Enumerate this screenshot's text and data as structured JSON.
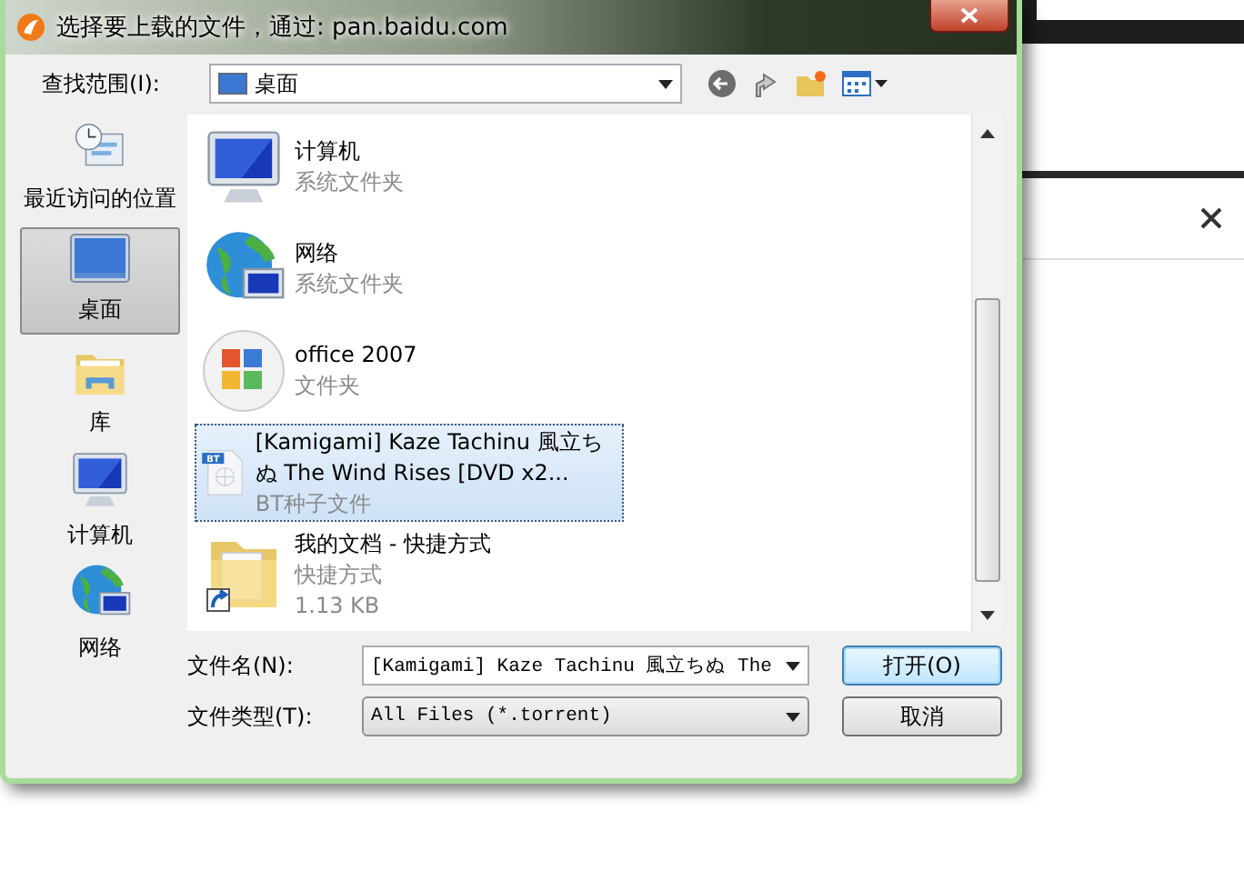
{
  "window": {
    "title": "选择要上载的文件，通过: pan.baidu.com"
  },
  "look_in": {
    "label": "查找范围(I):",
    "value": "桌面"
  },
  "places": [
    {
      "label": "最近访问的位置",
      "kind": "recent",
      "selected": false
    },
    {
      "label": "桌面",
      "kind": "desktop",
      "selected": true
    },
    {
      "label": "库",
      "kind": "library",
      "selected": false
    },
    {
      "label": "计算机",
      "kind": "computer",
      "selected": false
    },
    {
      "label": "网络",
      "kind": "network",
      "selected": false
    }
  ],
  "files": [
    {
      "name": "计算机",
      "kind": "computer",
      "details": [
        "系统文件夹"
      ],
      "selected": false
    },
    {
      "name": "网络",
      "kind": "network",
      "details": [
        "系统文件夹"
      ],
      "selected": false
    },
    {
      "name": "office 2007",
      "kind": "office",
      "details": [
        "文件夹"
      ],
      "selected": false
    },
    {
      "name": "[Kamigami] Kaze Tachinu 風立ちぬ The Wind Rises [DVD x2...",
      "kind": "torrent",
      "badge": "BT",
      "details": [
        "BT种子文件"
      ],
      "selected": true
    },
    {
      "name": "我的文档 - 快捷方式",
      "kind": "shortcut",
      "details": [
        "快捷方式",
        "1.13 KB"
      ],
      "selected": false
    }
  ],
  "file_name": {
    "label": "文件名(N):",
    "value": "[Kamigami] Kaze Tachinu 風立ちぬ The"
  },
  "file_type": {
    "label": "文件类型(T):",
    "value": "All Files (*.torrent)"
  },
  "buttons": [
    {
      "label": "打开(O)",
      "kind": "default"
    },
    {
      "label": "取消",
      "kind": "normal"
    }
  ]
}
